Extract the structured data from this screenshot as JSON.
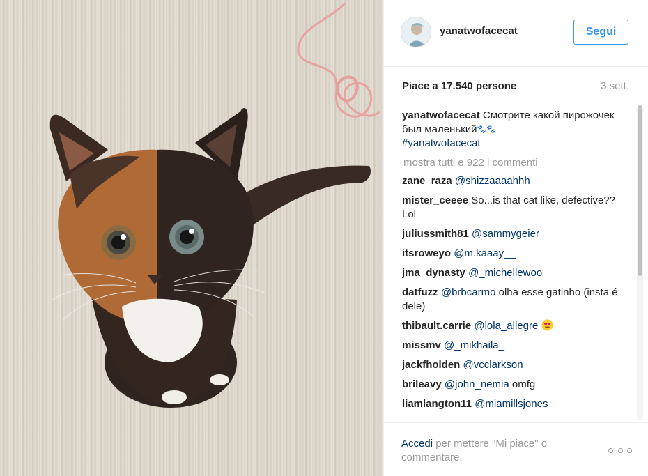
{
  "post": {
    "image_description": "kitten"
  },
  "header": {
    "username": "yanatwofacecat",
    "follow_label": "Segui"
  },
  "stats": {
    "likes": "Piace a 17.540 persone",
    "time": "3 sett."
  },
  "caption": {
    "user": "yanatwofacecat",
    "text": "Смотрите какой пирожочек был маленький",
    "hashtag": "#yanatwofacecat"
  },
  "show_all": "mostra tutti e 922 i commenti",
  "comments": [
    {
      "user": "zane_raza",
      "mention": "@shizzaaaahhh",
      "text": ""
    },
    {
      "user": "mister_ceeee",
      "mention": "",
      "text": "So...is that cat like, defective?? Lol"
    },
    {
      "user": "juliussmith81",
      "mention": "@sammygeier",
      "text": ""
    },
    {
      "user": "itsroweyo",
      "mention": "@m.kaaay__",
      "text": ""
    },
    {
      "user": "jma_dynasty",
      "mention": "@_michellewoo",
      "text": ""
    },
    {
      "user": "datfuzz",
      "mention": "@brbcarmo",
      "text": "olha esse gatinho (insta é dele)"
    },
    {
      "user": "thibault.carrie",
      "mention": "@lola_allegre",
      "text": ""
    },
    {
      "user": "missmv",
      "mention": "@_mikhaila_",
      "text": ""
    },
    {
      "user": "jackfholden",
      "mention": "@vcclarkson",
      "text": ""
    },
    {
      "user": "brileavy",
      "mention": "@john_nemia",
      "text": "omfg"
    },
    {
      "user": "liamlangton11",
      "mention": "@miamillsjones",
      "text": ""
    }
  ],
  "footer": {
    "login_link": "Accedi",
    "login_text": "per mettere \"Mi piace\" o commentare."
  },
  "colors": {
    "link": "#3897f0",
    "mention": "#003569",
    "muted": "#999999"
  }
}
